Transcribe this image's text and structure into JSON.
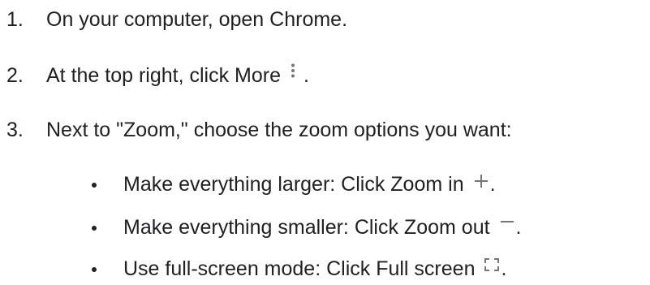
{
  "steps": [
    {
      "number": "1.",
      "text": "On your computer, open Chrome."
    },
    {
      "number": "2.",
      "text_before": "At the top right, click More",
      "icon": "more-vert-icon",
      "text_after": "."
    },
    {
      "number": "3.",
      "text": "Next to \"Zoom,\" choose the zoom options you want:"
    }
  ],
  "options": [
    {
      "text": "Make everything larger: Click Zoom in",
      "icon": "zoom-in-plus-icon",
      "text_after": "."
    },
    {
      "text": "Make everything smaller: Click Zoom out",
      "icon": "zoom-out-minus-icon",
      "text_after": "."
    },
    {
      "text": "Use full-screen mode: Click Full screen",
      "icon": "fullscreen-icon",
      "text_after": "."
    }
  ],
  "colors": {
    "text": "#202124",
    "icon": "#757575"
  }
}
